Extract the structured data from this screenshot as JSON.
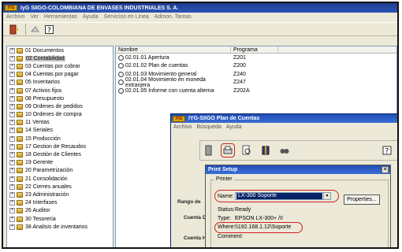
{
  "app": {
    "logo_text": "IYG",
    "title": "IyG SIIGO-COLOMBIANA DE ENVASES INDUSTRIALES S. A.",
    "menu": [
      "Archivo",
      "Ver",
      "Herramientas",
      "Ayuda",
      "Servicios en Linea",
      "Admon. Tareas"
    ]
  },
  "tree": {
    "items": [
      {
        "label": "01 Documentos",
        "selected": false
      },
      {
        "label": "02 Contabilidad",
        "selected": true
      },
      {
        "label": "03 Cuentas por cobrar",
        "selected": false
      },
      {
        "label": "04 Cuentas por pagar",
        "selected": false
      },
      {
        "label": "05 Inventarios",
        "selected": false
      },
      {
        "label": "07 Activos fijos",
        "selected": false
      },
      {
        "label": "08 Presupuesto",
        "selected": false
      },
      {
        "label": "09 Ordenes de pedidos",
        "selected": false
      },
      {
        "label": "10 Ordenes de compra",
        "selected": false
      },
      {
        "label": "11 Ventas",
        "selected": false
      },
      {
        "label": "14 Seriales",
        "selected": false
      },
      {
        "label": "15 Producción",
        "selected": false
      },
      {
        "label": "17 Gestion de Recaudos",
        "selected": false
      },
      {
        "label": "18 Gestión de Clientes",
        "selected": false
      },
      {
        "label": "19 Gerente",
        "selected": false
      },
      {
        "label": "20 Parametrización",
        "selected": false
      },
      {
        "label": "21 Consolidación",
        "selected": false
      },
      {
        "label": "22 Cierres anuales",
        "selected": false
      },
      {
        "label": "23 Administración",
        "selected": false
      },
      {
        "label": "24 Interfases",
        "selected": false
      },
      {
        "label": "26 Auditor",
        "selected": false
      },
      {
        "label": "30 Tesorería",
        "selected": false
      },
      {
        "label": "38 Analisis de inventarios",
        "selected": false
      }
    ]
  },
  "list": {
    "headers": [
      "Nombre",
      "Programa"
    ],
    "rows": [
      {
        "name": "02.01.01  Apertura",
        "program": "Z201"
      },
      {
        "name": "02.01.02  Plan de cuentas",
        "program": "Z200"
      },
      {
        "name": "02.01.03  Movimiento general",
        "program": "Z240"
      },
      {
        "name": "02.01.04  Movimiento en moneda extranjera",
        "program": "Z247"
      },
      {
        "name": "02.01.05  Informe con cuenta alterna",
        "program": "Z202A"
      }
    ]
  },
  "plan_window": {
    "title": "IYG-SIIGO Plan de Cuentas",
    "menu": [
      "Archivo",
      "Búsqueda",
      "Ayuda"
    ],
    "labels": {
      "rango": "Rango de",
      "cuenta_d": "Cuenta D",
      "cuenta_h": "Cuenta H"
    }
  },
  "print_setup": {
    "title": "Print Setup",
    "group_label": "Printer",
    "name_label": "Name:",
    "name_value": "LX-300 Soporte",
    "properties_label": "Properties...",
    "status_label": "Status:",
    "status_value": "Ready",
    "type_label": "Type:",
    "type_value": "EPSON LX-300+ /II",
    "where_label": "Where:",
    "where_value": "\\\\192.168.1.12\\Soporte",
    "comment_label": "Comment:"
  },
  "colors": {
    "titlebar": "#1d3c8c",
    "highlight": "#d02020",
    "panel": "#ece9d8"
  }
}
